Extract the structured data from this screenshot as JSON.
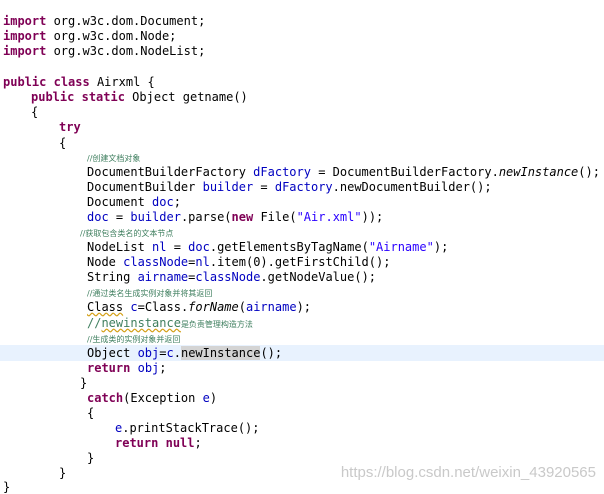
{
  "code": {
    "imports": [
      {
        "kw": "import",
        "text": " org.w3c.dom.Document;"
      },
      {
        "kw": "import",
        "text": " org.w3c.dom.Node;"
      },
      {
        "kw": "import",
        "text": " org.w3c.dom.NodeList;"
      }
    ],
    "class_decl": {
      "kw1": "public",
      "kw2": "class",
      "name": " Airxml {"
    },
    "method_decl": {
      "kw1": "public",
      "kw2": "static",
      "rest": " Object getname()"
    },
    "open_brace": "{",
    "try_kw": "try",
    "try_brace": "{",
    "comment_create_factory": "//创建文档对象",
    "line_factory": {
      "a": "DocumentBuilderFactory ",
      "var": "dFactory",
      "b": " = DocumentBuilderFactory.",
      "call": "newInstance",
      "c": "();"
    },
    "line_builder": {
      "a": "DocumentBuilder ",
      "var": "builder",
      "b": " = ",
      "var2": "dFactory",
      "c": ".newDocumentBuilder();"
    },
    "line_doc_decl": {
      "a": "Document ",
      "var": "doc",
      "b": ";"
    },
    "line_parse": {
      "var": "doc",
      "a": " = ",
      "var2": "builder",
      "b": ".parse(",
      "kw": "new",
      "c": " File(",
      "str": "\"Air.xml\"",
      "d": "));"
    },
    "comment_get_text": "//获取包含类名的文本节点",
    "line_nodelist": {
      "a": "NodeList ",
      "var": "nl",
      "b": " = ",
      "var2": "doc",
      "c": ".getElementsByTagName(",
      "str": "\"Airname\"",
      "d": ");"
    },
    "line_classnode": {
      "a": "Node ",
      "var": "classNode",
      "b": "=",
      "var2": "nl",
      "c": ".item(0).getFirstChild();"
    },
    "line_airname": {
      "a": "String ",
      "var": "airname",
      "b": "=",
      "var2": "classNode",
      "c": ".getNodeValue();"
    },
    "comment_generate": "//通过类名生成实例对象并将其返回",
    "line_class": {
      "a": "Class",
      "b": " ",
      "var": "c",
      "c": "=Class.",
      "call": "forName",
      "d": "(",
      "var2": "airname",
      "e": ");"
    },
    "comment_newinstance": {
      "a": "//",
      "word": "newinstance",
      "b": "是负责管理构造方法"
    },
    "comment_instance": "//生成类的实例对象并返回",
    "line_obj": {
      "a": "Object ",
      "var": "obj",
      "b": "=",
      "var2": "c",
      "c": ".",
      "call": "newInstance",
      "d": "();"
    },
    "line_return_obj": {
      "kw": "return",
      "a": " ",
      "var": "obj",
      "b": ";"
    },
    "close_try": "}",
    "catch_line": {
      "kw": "catch",
      "a": "(Exception ",
      "var": "e",
      "b": ")"
    },
    "catch_open": "{",
    "line_print": {
      "var": "e",
      "a": ".printStackTrace();"
    },
    "line_return_null": {
      "kw": "return",
      "a": " ",
      "kw2": "null",
      "b": ";"
    },
    "catch_close": "}",
    "method_close": "}",
    "class_close_partial": "}"
  },
  "watermark": "https://blog.csdn.net/weixin_43920565",
  "colors": {
    "keyword": "#7f0055",
    "string": "#2a00ff",
    "field": "#0000c0",
    "comment": "#3f7f5f",
    "current_line": "#e8f2fe"
  }
}
